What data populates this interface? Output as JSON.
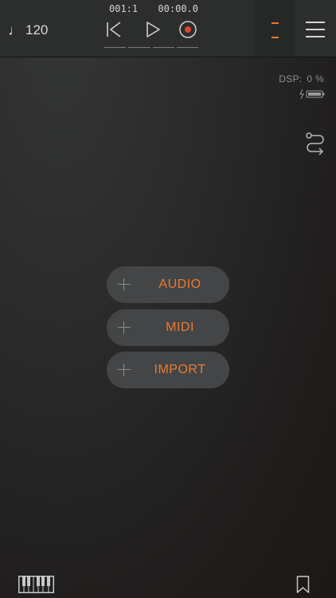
{
  "topbar": {
    "tempo": "120",
    "tempo_icon": "music-note-icon",
    "counter": {
      "bar_beat": "001:1",
      "time": "00:00.0"
    },
    "transport": {
      "rewind_icon": "skip-back-icon",
      "play_icon": "play-icon",
      "record_icon": "record-icon"
    },
    "menu_icon": "hamburger-menu-icon"
  },
  "status": {
    "dsp_label": "DSP:",
    "dsp_value": "0 %",
    "battery_icon": "battery-charging-icon"
  },
  "add_track": {
    "buttons": [
      {
        "label": "AUDIO"
      },
      {
        "label": "MIDI"
      },
      {
        "label": "IMPORT"
      }
    ]
  },
  "bottom": {
    "keyboard_icon": "piano-keyboard-icon",
    "bookmark_icon": "bookmark-icon"
  },
  "colors": {
    "accent": "#ea7a32",
    "record": "#e0452c",
    "background": "#262626",
    "button_bg": "#444546"
  }
}
